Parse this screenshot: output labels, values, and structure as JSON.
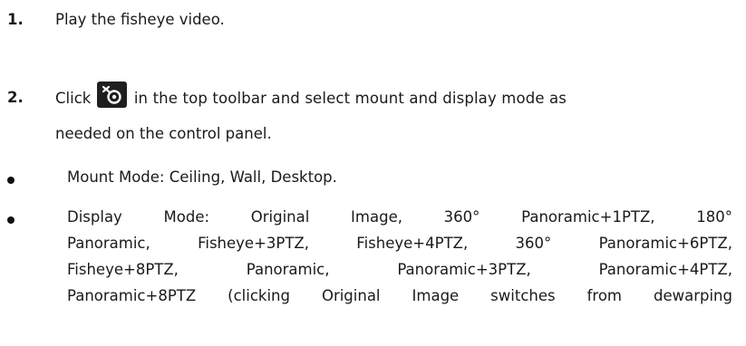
{
  "steps": [
    {
      "number": "1.",
      "line1": "Play the fisheye video."
    },
    {
      "number": "2.",
      "line1_before_icon": "Click",
      "icon": "fisheye-mode-icon",
      "line1_after_icon": "in the top toolbar and select mount and display mode as",
      "line2": "needed on the control panel."
    }
  ],
  "bullets": [
    {
      "line1": "Mount Mode: Ceiling, Wall, Desktop."
    },
    {
      "line1": "Display  Mode:  Original  Image,  360°  Panoramic+1PTZ,  180°",
      "line2": "Panoramic,  Fisheye+3PTZ,  Fisheye+4PTZ,  360°  Panoramic+6PTZ,",
      "line3": "Fisheye+8PTZ,  Panoramic,  Panoramic+3PTZ,  Panoramic+4PTZ,",
      "line4": "Panoramic+8PTZ (clicking Original Image switches from dewarping"
    }
  ]
}
